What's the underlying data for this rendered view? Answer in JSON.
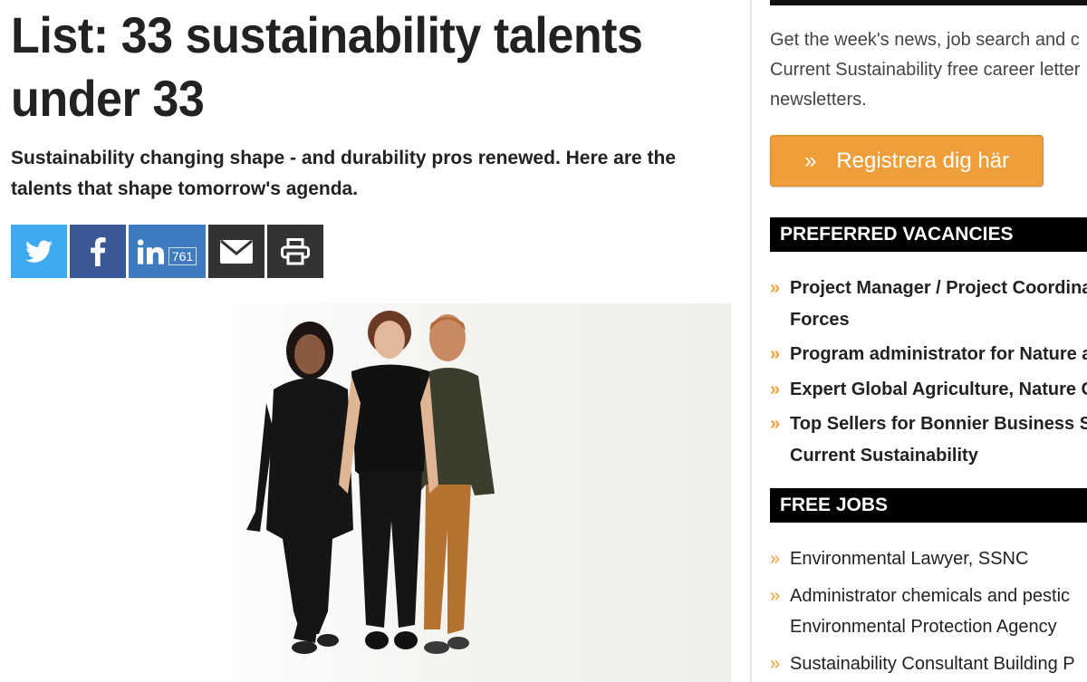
{
  "article": {
    "title": "List: 33 sustainability talents under 33",
    "lead": "Sustainability changing shape - and durability pros renewed. Here are the talents that shape tomorrow's agenda.",
    "share": {
      "linkedin_count": "761"
    }
  },
  "sidebar": {
    "intro": "Get the week's news, job search and c\nCurrent Sustainability free career letter\nnewsletters.",
    "register_arrows": "»",
    "register_label": "Registrera dig här",
    "preferred_vacancies": {
      "heading": "PREFERRED VACANCIES",
      "items": [
        "Project Manager / Project Coordina\nForces",
        "Program administrator for Nature a",
        "Expert Global Agriculture, Nature C",
        "Top Sellers for Bonnier Business Su\nCurrent Sustainability"
      ]
    },
    "free_jobs": {
      "heading": "FREE JOBS",
      "items": [
        "Environmental Lawyer, SSNC",
        "Administrator chemicals and pestic\nEnvironmental Protection Agency",
        "Sustainability Consultant Building P"
      ]
    }
  },
  "colors": {
    "twitter": "#3da9f0",
    "facebook": "#3b5998",
    "linkedin": "#3f7bbf",
    "dark": "#333333",
    "accent_orange": "#ee9e3a"
  }
}
